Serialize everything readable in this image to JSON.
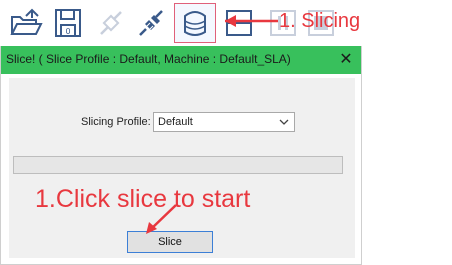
{
  "toolbar": {
    "buttons": [
      {
        "icon": "open-folder-icon",
        "state": "normal"
      },
      {
        "icon": "save-disk-icon",
        "state": "normal"
      },
      {
        "icon": "disconnect-plug-icon",
        "state": "disabled"
      },
      {
        "icon": "connect-plug-icon",
        "state": "normal"
      },
      {
        "icon": "slice-layers-icon",
        "state": "active"
      },
      {
        "icon": "preview-icon",
        "state": "normal"
      },
      {
        "icon": "pause-icon",
        "state": "disabled"
      },
      {
        "icon": "stop-icon",
        "state": "disabled"
      }
    ],
    "annotation": "1. Slicing"
  },
  "dialog": {
    "title": "Slice!   ( Slice Profile : Default, Machine : Default_SLA)",
    "close_glyph": "✕",
    "profile_label": "Slicing Profile:",
    "profile_value": "Default",
    "progress": 0,
    "annotation": "1.Click slice to start",
    "slice_button": "Slice"
  },
  "colors": {
    "titlebar": "#38c05c",
    "annotation": "#e8383f",
    "icon": "#3a5a8a"
  }
}
